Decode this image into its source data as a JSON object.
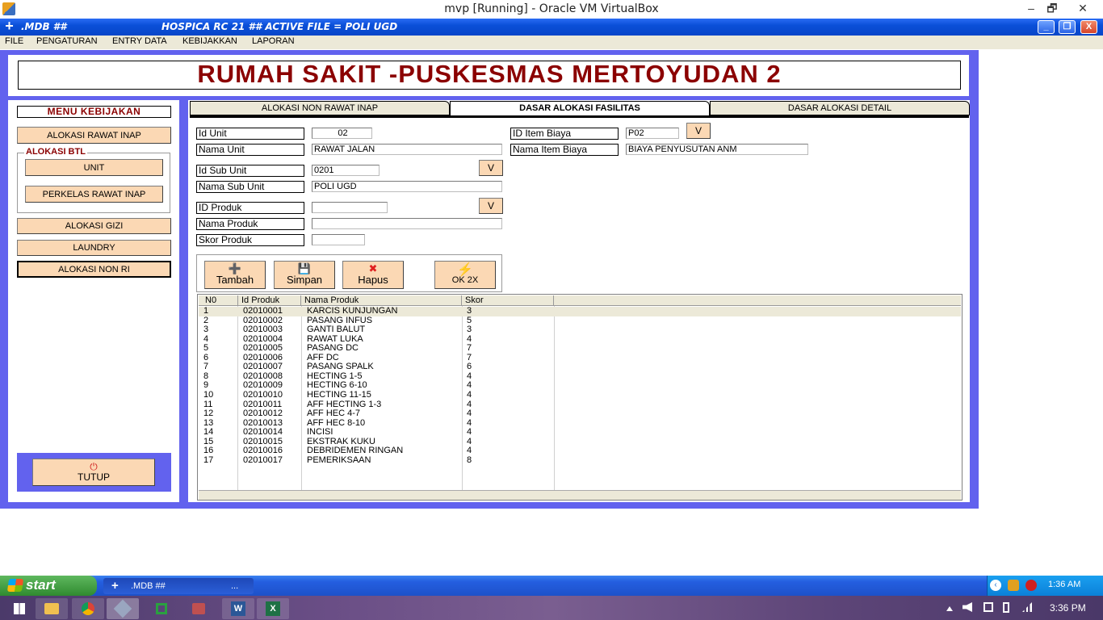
{
  "vbox": {
    "title": "mvp [Running] - Oracle VM VirtualBox",
    "min": "–",
    "max": "🗗",
    "close": "✕"
  },
  "app": {
    "mdb": ".MDB ##",
    "header": "HOSPICA RC 21 ## ACTIVE FILE = POLI UGD",
    "icon": "+",
    "min": "_",
    "max": "❐",
    "close": "X"
  },
  "menu": [
    "FILE",
    "PENGATURAN",
    "ENTRY DATA",
    "KEBIJAKKAN",
    "LAPORAN"
  ],
  "hospital_title": "RUMAH SAKIT -PUSKESMAS MERTOYUDAN 2",
  "sidebar": {
    "title": "MENU KEBIJAKAN",
    "alokasi_rawat_inap": "ALOKASI RAWAT INAP",
    "btl_label": "ALOKASI BTL",
    "unit": "UNIT",
    "perkelas": "PERKELAS RAWAT INAP",
    "gizi": "ALOKASI GIZI",
    "laundry": "LAUNDRY",
    "non_ri": "ALOKASI NON RI",
    "tutup": "TUTUP",
    "tutup_icon": "power-icon"
  },
  "tabs": [
    "ALOKASI NON RAWAT INAP",
    "DASAR ALOKASI FASILITAS",
    "DASAR ALOKASI DETAIL"
  ],
  "form": {
    "id_unit_label": "Id Unit",
    "id_unit": "02",
    "nama_unit_label": "Nama Unit",
    "nama_unit": "RAWAT JALAN",
    "id_sub_unit_label": "Id Sub Unit",
    "id_sub_unit": "0201",
    "nama_sub_unit_label": "Nama Sub Unit",
    "nama_sub_unit": "POLI UGD",
    "id_produk_label": "ID Produk",
    "id_produk": "",
    "nama_produk_label": "Nama Produk",
    "nama_produk": "",
    "skor_produk_label": "Skor Produk",
    "skor_produk": "",
    "id_item_biaya_label": "ID Item Biaya",
    "id_item_biaya": "P02",
    "nama_item_biaya_label": "Nama Item Biaya",
    "nama_item_biaya": "BIAYA PENYUSUTAN ANM",
    "v": "V"
  },
  "actions": {
    "tambah": "Tambah",
    "simpan": "Simpan",
    "hapus": "Hapus",
    "ok": "OK 2X",
    "tambah_icon": "➕",
    "simpan_icon": "💾",
    "hapus_icon": "✖",
    "ok_icon": "⚡"
  },
  "grid": {
    "headers": [
      "N0",
      "Id Produk",
      "Nama Produk",
      "Skor"
    ],
    "rows": [
      [
        "1",
        "02010001",
        "KARCIS KUNJUNGAN",
        "3"
      ],
      [
        "2",
        "02010002",
        "PASANG INFUS",
        "5"
      ],
      [
        "3",
        "02010003",
        "GANTI BALUT",
        "3"
      ],
      [
        "4",
        "02010004",
        "RAWAT LUKA",
        "4"
      ],
      [
        "5",
        "02010005",
        "PASANG DC",
        "7"
      ],
      [
        "6",
        "02010006",
        "AFF DC",
        "7"
      ],
      [
        "7",
        "02010007",
        "PASANG SPALK",
        "6"
      ],
      [
        "8",
        "02010008",
        "HECTING 1-5",
        "4"
      ],
      [
        "9",
        "02010009",
        "HECTING 6-10",
        "4"
      ],
      [
        "10",
        "02010010",
        "HECTING 11-15",
        "4"
      ],
      [
        "11",
        "02010011",
        "AFF HECTING 1-3",
        "4"
      ],
      [
        "12",
        "02010012",
        "AFF HEC 4-7",
        "4"
      ],
      [
        "13",
        "02010013",
        "AFF HEC 8-10",
        "4"
      ],
      [
        "14",
        "02010014",
        "INCISI",
        "4"
      ],
      [
        "15",
        "02010015",
        "EKSTRAK KUKU",
        "4"
      ],
      [
        "16",
        "02010016",
        "DEBRIDEMEN RINGAN",
        "4"
      ],
      [
        "17",
        "02010017",
        "PEMERIKSAAN",
        "8"
      ]
    ]
  },
  "xp_taskbar": {
    "start": "start",
    "task": ".MDB ##",
    "task_more": "...",
    "time": "1:36 AM"
  },
  "win_taskbar": {
    "time": "3:36 PM",
    "word": "W",
    "excel": "X"
  }
}
